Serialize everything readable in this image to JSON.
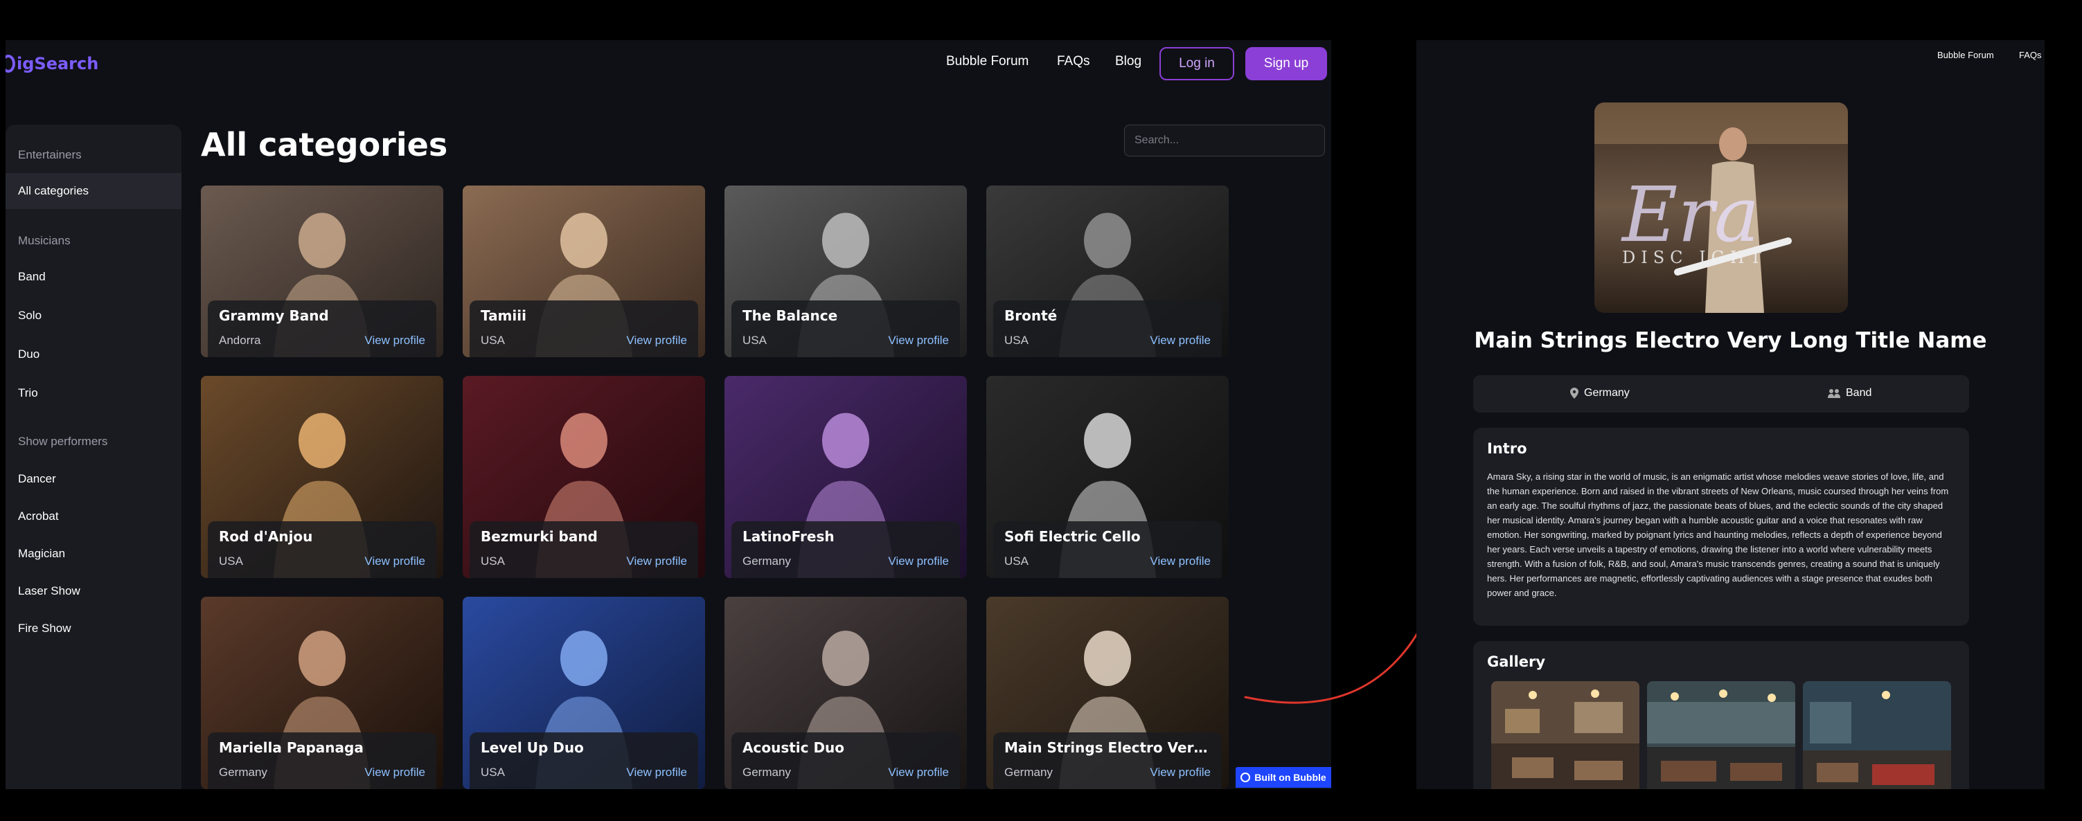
{
  "left": {
    "logo": "igSearch",
    "nav": {
      "forum": "Bubble Forum",
      "faqs": "FAQs",
      "blog": "Blog",
      "login": "Log in",
      "signup": "Sign up"
    },
    "title": "All categories",
    "search_placeholder": "Search...",
    "sidebar": [
      {
        "label": "Entertainers",
        "kind": "heading"
      },
      {
        "label": "All categories",
        "kind": "active"
      },
      {
        "label": "Musicians",
        "kind": "heading"
      },
      {
        "label": "Band",
        "kind": "link"
      },
      {
        "label": "Solo",
        "kind": "link"
      },
      {
        "label": "Duo",
        "kind": "link"
      },
      {
        "label": "Trio",
        "kind": "link"
      },
      {
        "label": "Show performers",
        "kind": "heading"
      },
      {
        "label": "Dancer",
        "kind": "link"
      },
      {
        "label": "Acrobat",
        "kind": "link"
      },
      {
        "label": "Magician",
        "kind": "link"
      },
      {
        "label": "Laser Show",
        "kind": "link"
      },
      {
        "label": "Fire Show",
        "kind": "link"
      }
    ],
    "cards": [
      {
        "name": "Grammy Band",
        "location": "Andorra",
        "view": "View profile"
      },
      {
        "name": "Tamiii",
        "location": "USA",
        "view": "View profile"
      },
      {
        "name": "The Balance",
        "location": "USA",
        "view": "View profile"
      },
      {
        "name": "Bronté",
        "location": "USA",
        "view": "View profile"
      },
      {
        "name": "Rod d'Anjou",
        "location": "USA",
        "view": "View profile"
      },
      {
        "name": "Bezmurki band",
        "location": "USA",
        "view": "View profile"
      },
      {
        "name": "LatinoFresh",
        "location": "Germany",
        "view": "View profile"
      },
      {
        "name": "Sofi Electric Cello",
        "location": "USA",
        "view": "View profile"
      },
      {
        "name": "Mariella Papanaga",
        "location": "Germany",
        "view": "View profile"
      },
      {
        "name": "Level Up Duo",
        "location": "USA",
        "view": "View profile"
      },
      {
        "name": "Acoustic Duo",
        "location": "Germany",
        "view": "View profile"
      },
      {
        "name": "Main Strings Electro Very Long...",
        "location": "Germany",
        "view": "View profile"
      }
    ],
    "badge": "Built on Bubble"
  },
  "right": {
    "nav": {
      "forum": "Bubble Forum",
      "faqs": "FAQs"
    },
    "title": "Main Strings Electro Very Long Title Name",
    "location": "Germany",
    "category": "Band",
    "intro_heading": "Intro",
    "intro_text": "Amara Sky, a rising star in the world of music, is an enigmatic artist whose melodies weave stories of love, life, and the human experience. Born and raised in the vibrant streets of New Orleans, music coursed through her veins from an early age. The soulful rhythms of jazz, the passionate beats of blues, and the eclectic sounds of the city shaped her musical identity.  Amara's journey began with a humble acoustic guitar and a voice that resonates with raw emotion. Her songwriting, marked by poignant lyrics and haunting melodies, reflects a depth of experience beyond her years. Each verse unveils a tapestry of emotions, drawing the listener into a world where vulnerability meets strength.  With a fusion of folk, R&B, and soul, Amara's music transcends genres, creating a sound that is uniquely hers. Her performances are magnetic, effortlessly captivating audiences with a stage presence that exudes both power and grace.",
    "gallery_heading": "Gallery"
  },
  "colors": {
    "accent": "#8b3fd6",
    "link": "#8ec0ff",
    "arrow": "#e0362c",
    "badge": "#1e46ff"
  }
}
